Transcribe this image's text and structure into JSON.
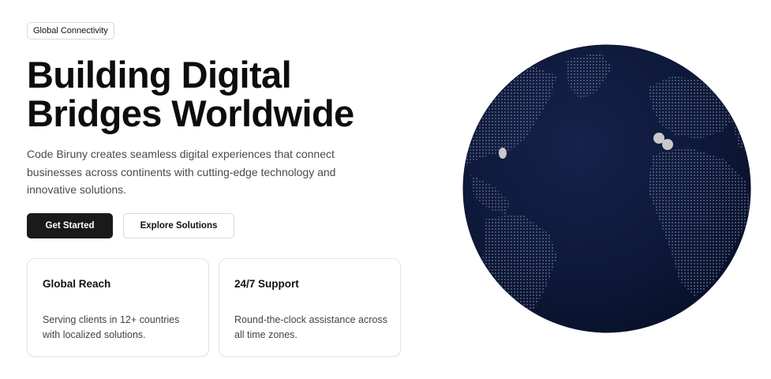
{
  "badge": "Global Connectivity",
  "hero": {
    "headline_line1": "Building Digital",
    "headline_line2": "Bridges Worldwide",
    "description": "Code Biruny creates seamless digital experiences that connect businesses across continents with cutting-edge technology and innovative solutions."
  },
  "buttons": {
    "primary": "Get Started",
    "secondary": "Explore Solutions"
  },
  "cards": [
    {
      "title": "Global Reach",
      "text": "Serving clients in 12+ countries with localized solutions."
    },
    {
      "title": "24/7 Support",
      "text": "Round-the-clock assistance across all time zones."
    }
  ],
  "colors": {
    "globe": "#0d1838",
    "land_dots": "#7f8aa8",
    "markers": "#c9c9c9",
    "primary_button": "#1a1a1a"
  }
}
